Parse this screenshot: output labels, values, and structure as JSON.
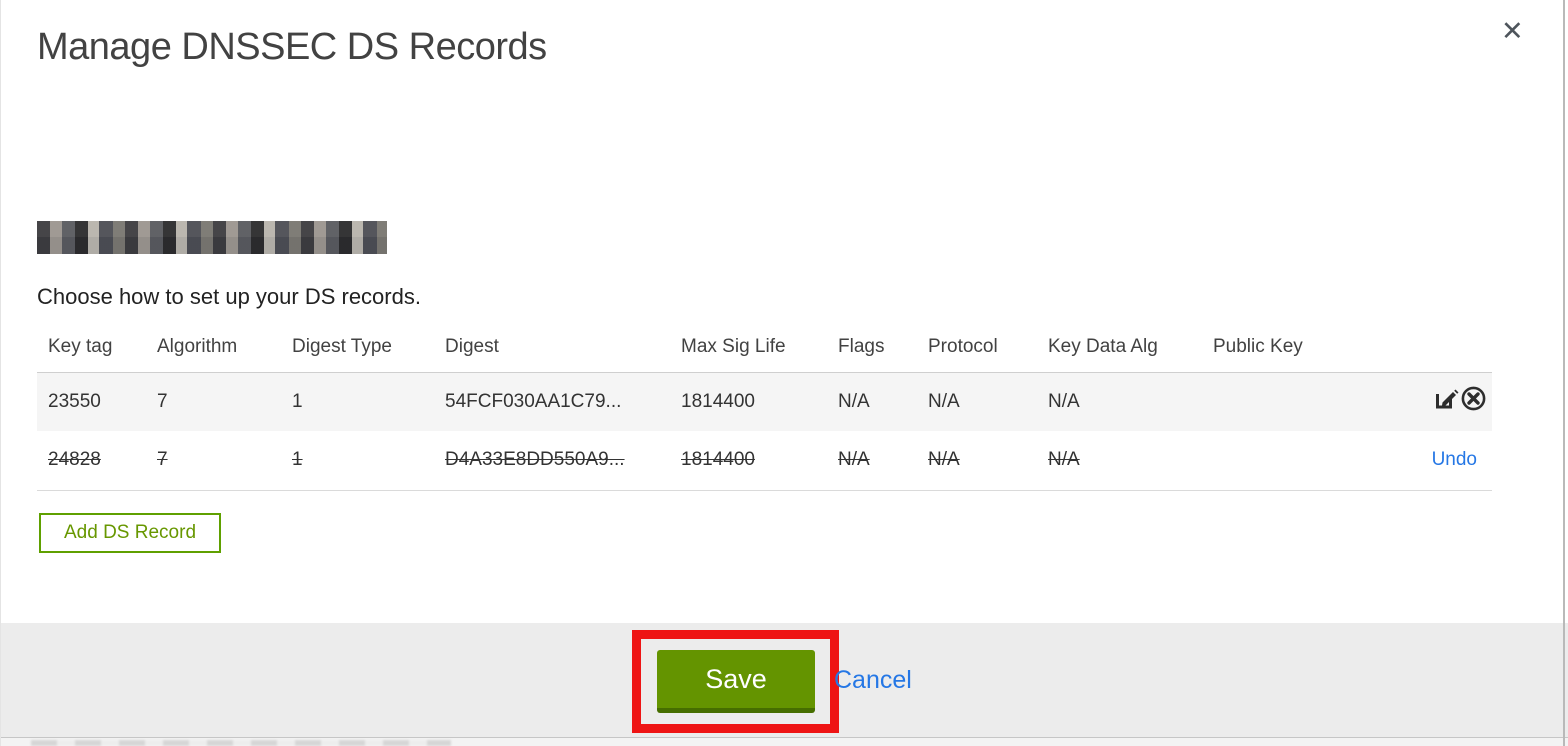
{
  "modal": {
    "title": "Manage DNSSEC DS Records",
    "close_icon": "close-x-icon",
    "close_glyph": "✕",
    "domain": {
      "redacted": true
    },
    "instruction": "Choose how to set up your DS records.",
    "table": {
      "columns": [
        "Key tag",
        "Algorithm",
        "Digest Type",
        "Digest",
        "Max Sig Life",
        "Flags",
        "Protocol",
        "Key Data Alg",
        "Public Key"
      ],
      "rows": [
        {
          "cells": [
            "23550",
            "7",
            "1",
            "54FCF030AA1C79...",
            "1814400",
            "N/A",
            "N/A",
            "N/A",
            ""
          ],
          "state": "normal",
          "action_icons": [
            "edit-icon",
            "delete-circle-x-icon"
          ]
        },
        {
          "cells": [
            "24828",
            "7",
            "1",
            "D4A33E8DD550A9...",
            "1814400",
            "N/A",
            "N/A",
            "N/A",
            ""
          ],
          "state": "deleted",
          "action_label": "Undo"
        }
      ]
    },
    "add_button_label": "Add DS Record",
    "footer": {
      "save_label": "Save",
      "cancel_label": "Cancel"
    },
    "annotations": {
      "save_highlight": "red-rectangle"
    },
    "colors": {
      "accent_green": "#649400",
      "add_button_green": "#5fa000",
      "link_blue": "#2577e5",
      "annotation_red": "#ee1414",
      "footer_gray": "#ececec"
    }
  }
}
